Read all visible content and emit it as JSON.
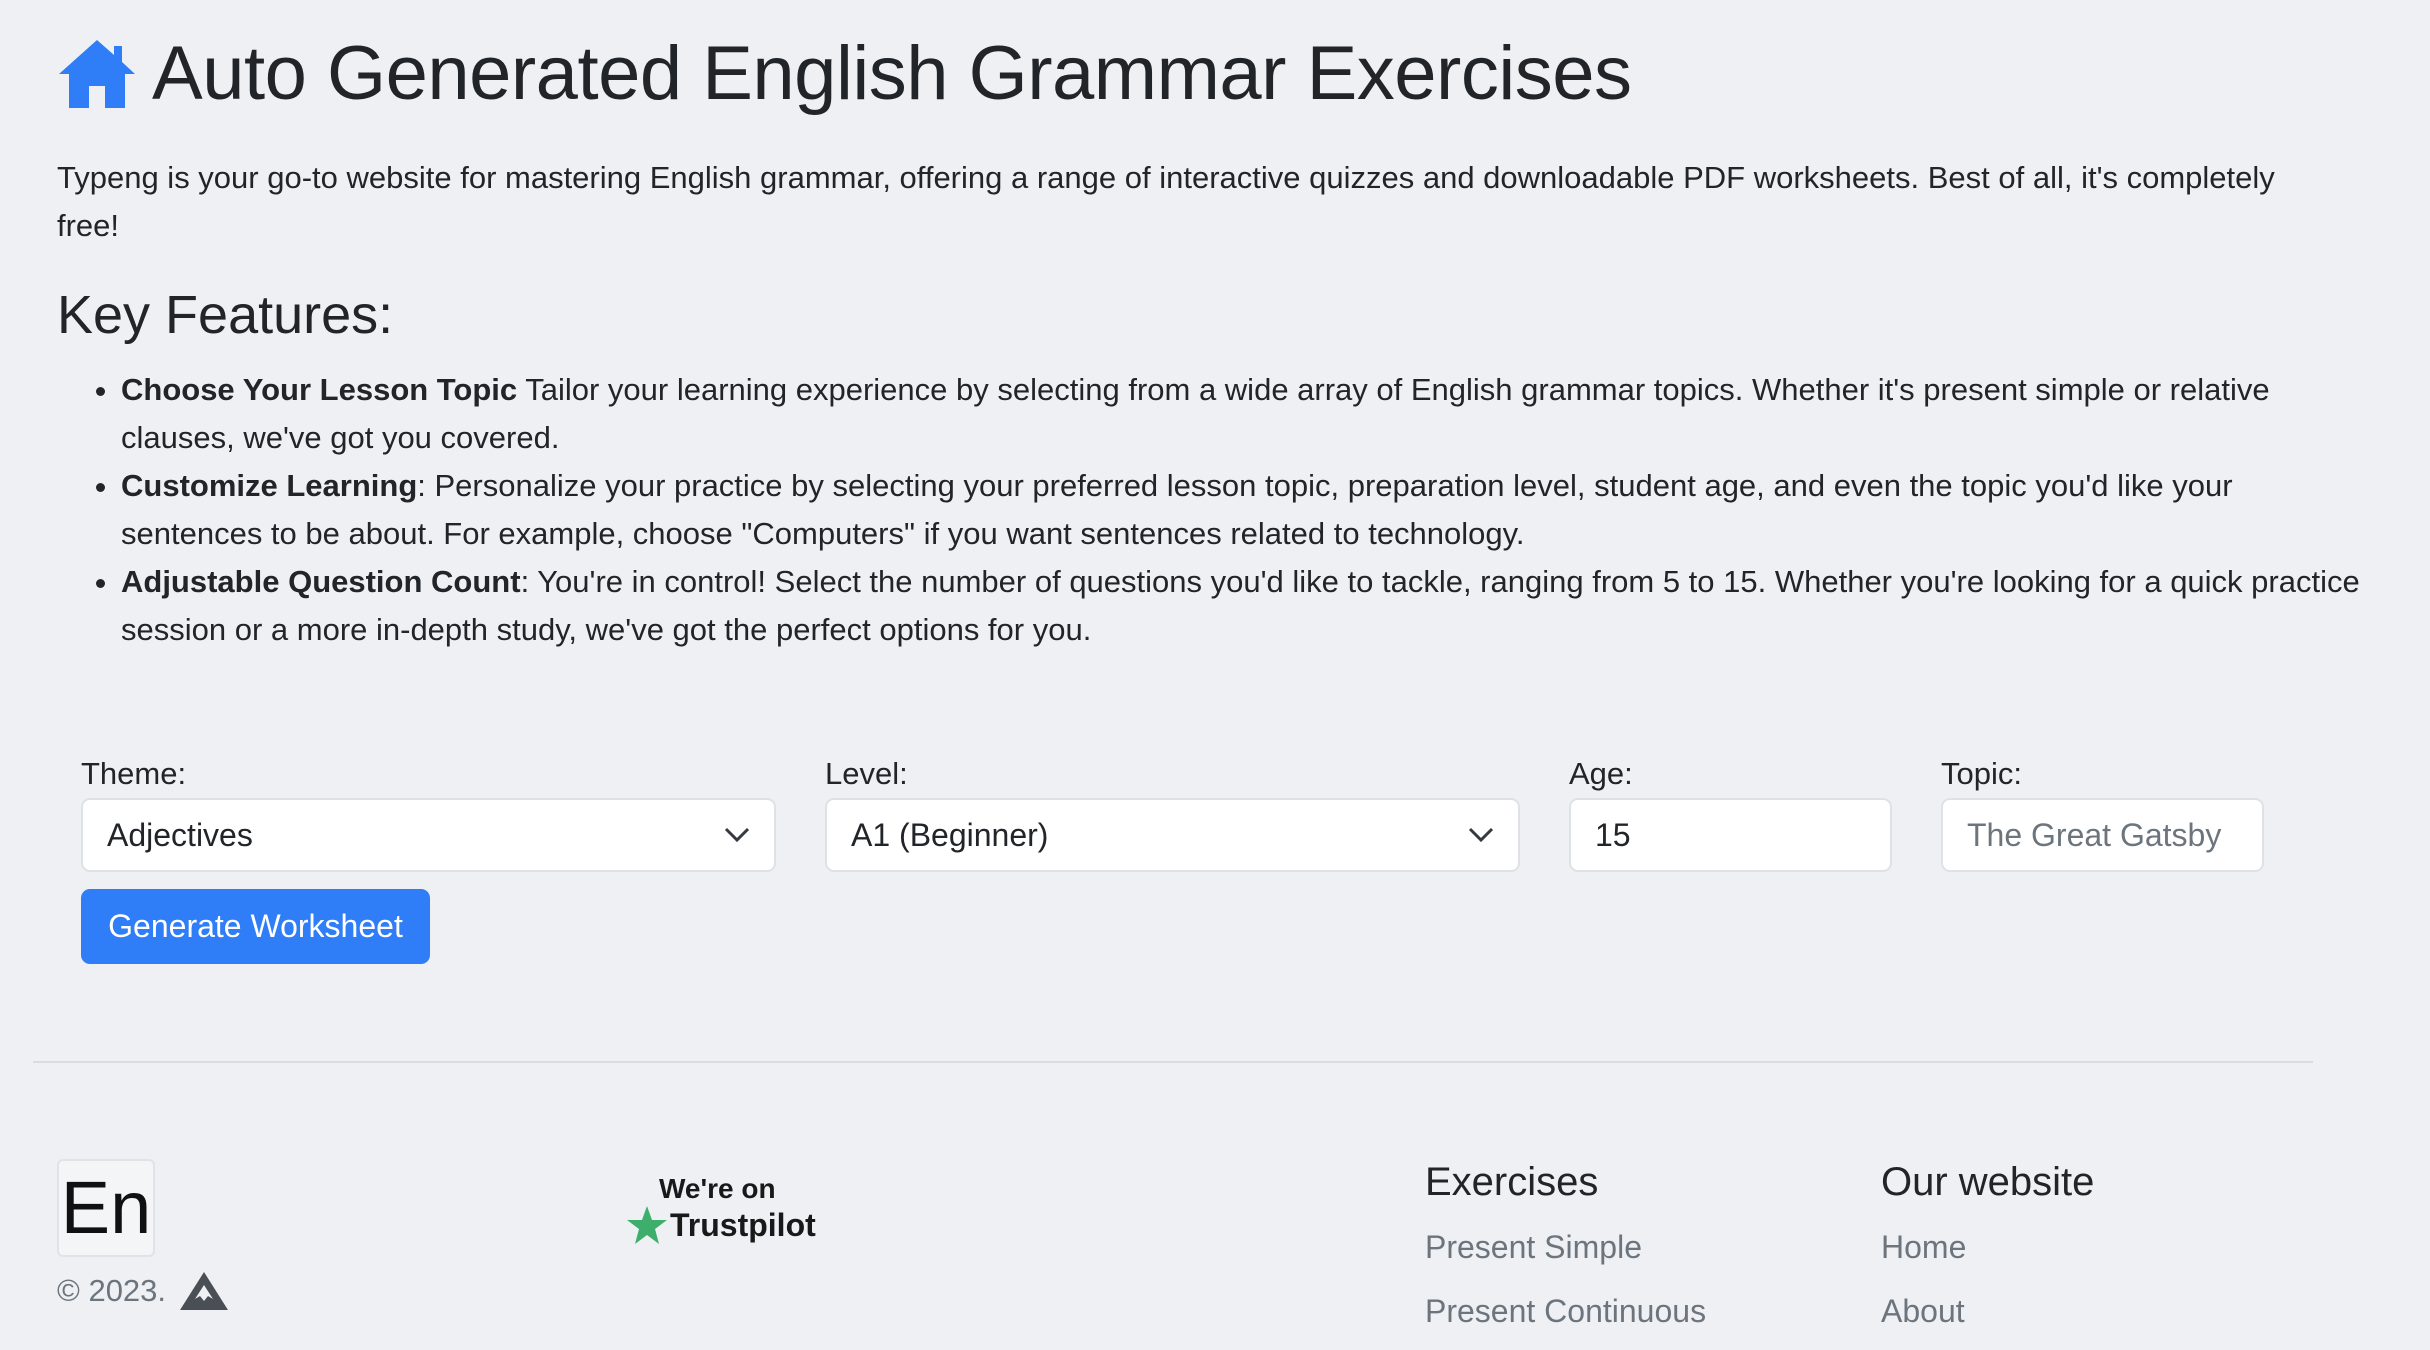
{
  "header": {
    "title": "Auto Generated English Grammar Exercises",
    "home_icon": "house-icon"
  },
  "intro": "Typeng is your go-to website for mastering English grammar, offering a range of interactive quizzes and downloadable PDF worksheets. Best of all, it's completely free!",
  "features": {
    "heading": "Key Features:",
    "items": [
      {
        "title": "Choose Your Lesson Topic",
        "text": " Tailor your learning experience by selecting from a wide array of English grammar topics. Whether it's present simple or relative clauses, we've got you covered."
      },
      {
        "title": "Customize Learning",
        "text": ": Personalize your practice by selecting your preferred lesson topic, preparation level, student age, and even the topic you'd like your sentences to be about. For example, choose \"Computers\" if you want sentences related to technology."
      },
      {
        "title": "Adjustable Question Count",
        "text": ": You're in control! Select the number of questions you'd like to tackle, ranging from 5 to 15. Whether you're looking for a quick practice session or a more in-depth study, we've got the perfect options for you."
      }
    ]
  },
  "form": {
    "theme": {
      "label": "Theme:",
      "value": "Adjectives"
    },
    "level": {
      "label": "Level:",
      "value": "A1 (Beginner)"
    },
    "age": {
      "label": "Age:",
      "value": "15"
    },
    "topic": {
      "label": "Topic:",
      "placeholder": "The Great Gatsby"
    },
    "submit_label": "Generate Worksheet"
  },
  "footer": {
    "logo_text": "En",
    "copyright": "© 2023.",
    "trustpilot_top": "We're on",
    "trustpilot_brand": "Trustpilot",
    "exercises": {
      "heading": "Exercises",
      "links": [
        "Present Simple",
        "Present Continuous"
      ]
    },
    "website": {
      "heading": "Our website",
      "links": [
        "Home",
        "About"
      ]
    }
  },
  "colors": {
    "background": "#eef0f4",
    "primary": "#2f7df7",
    "trustpilot_star": "#3dae6c",
    "muted": "#6c757d"
  }
}
